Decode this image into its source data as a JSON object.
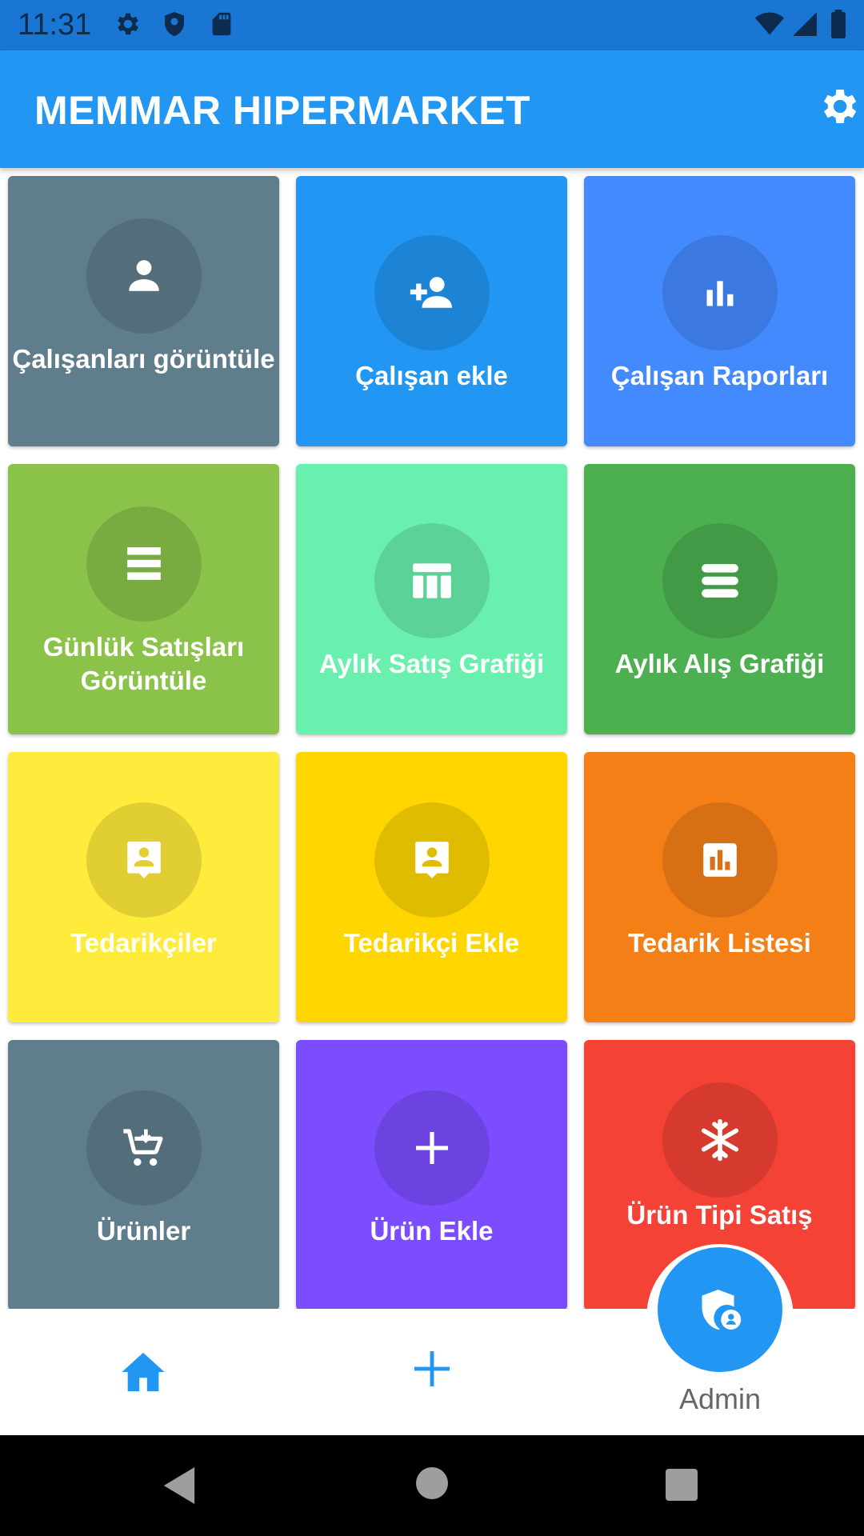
{
  "status_bar": {
    "time": "11:31",
    "icons": [
      "gear-icon",
      "shield-icon",
      "sd-card-icon",
      "wifi-icon",
      "signal-icon",
      "battery-icon"
    ]
  },
  "app_bar": {
    "title": "MEMMAR HIPERMARKET",
    "settings_icon": "gear-icon"
  },
  "tiles": [
    {
      "label": "Çalışanları görüntüle",
      "icon": "person-icon",
      "color": "#607d8b"
    },
    {
      "label": "Çalışan ekle",
      "icon": "person-add-icon",
      "color": "#2196f3"
    },
    {
      "label": "Çalışan Raporları",
      "icon": "bar-chart-icon",
      "color": "#448aff"
    },
    {
      "label": "Günlük Satışları Görüntüle",
      "icon": "list-icon",
      "color": "#8bc34a"
    },
    {
      "label": "Aylık Satış Grafiği",
      "icon": "table-icon",
      "color": "#69f0ae"
    },
    {
      "label": "Aylık Alış Grafiği",
      "icon": "storage-icon",
      "color": "#4caf50"
    },
    {
      "label": "Tedarikçiler",
      "icon": "contact-icon",
      "color": "#ffeb3b"
    },
    {
      "label": "Tedarikçi Ekle",
      "icon": "contact-icon",
      "color": "#ffd600"
    },
    {
      "label": "Tedarik Listesi",
      "icon": "chart-box-icon",
      "color": "#f57f17"
    },
    {
      "label": "Ürünler",
      "icon": "cart-icon",
      "color": "#607d8b"
    },
    {
      "label": "Ürün Ekle",
      "icon": "plus-icon",
      "color": "#7c4dff"
    },
    {
      "label": "Ürün Tipi Satış",
      "icon": "snowflake-icon",
      "color": "#f44336"
    }
  ],
  "bottom_nav": {
    "home_icon": "home-icon",
    "add_icon": "plus-icon",
    "admin_icon": "admin-shield-icon",
    "admin_label": "Admin"
  },
  "system_nav": [
    "back-icon",
    "home-circle-icon",
    "recents-icon"
  ]
}
